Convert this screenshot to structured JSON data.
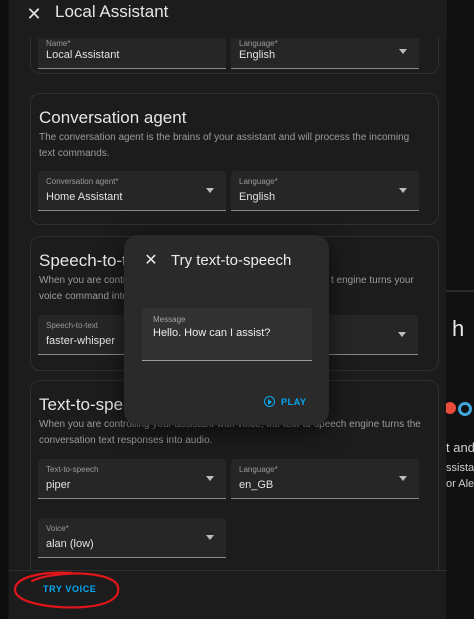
{
  "background_page": {
    "frag_h": "h",
    "frag_and": "t and",
    "frag_assist": "ssista",
    "frag_alex": "or Alex"
  },
  "dialog": {
    "title": "Local Assistant",
    "top_fields": {
      "name": {
        "label": "Name*",
        "value": "Local Assistant"
      },
      "language": {
        "label": "Language*",
        "value": "English"
      }
    },
    "conversation": {
      "title": "Conversation agent",
      "description": "The conversation agent is the brains of your assistant and will process the incoming text commands.",
      "agent": {
        "label": "Conversation agent*",
        "value": "Home Assistant"
      },
      "language": {
        "label": "Language*",
        "value": "English"
      }
    },
    "stt": {
      "title": "Speech-to-te",
      "description_left": "When you are contro",
      "description_right": "t engine turns your",
      "description_line2": "voice command into",
      "engine": {
        "label": "Speech-to-text",
        "value": "faster-whisper"
      }
    },
    "tts": {
      "title": "Text-to-spee",
      "description": "When you are controlling your assistant with voice, the text-to-speech engine turns the conversation text responses into audio.",
      "engine": {
        "label": "Text-to-speech",
        "value": "piper"
      },
      "language": {
        "label": "Language*",
        "value": "en_GB"
      },
      "voice": {
        "label": "Voice*",
        "value": "alan (low)"
      }
    },
    "try_voice_label": "TRY VOICE"
  },
  "tts_dialog": {
    "title": "Try text-to-speech",
    "message": {
      "label": "Message",
      "value": "Hello. How can I assist?"
    },
    "play_label": "PLAY"
  },
  "colors": {
    "accent": "#03a9f4",
    "annotation": "#e0161b"
  }
}
